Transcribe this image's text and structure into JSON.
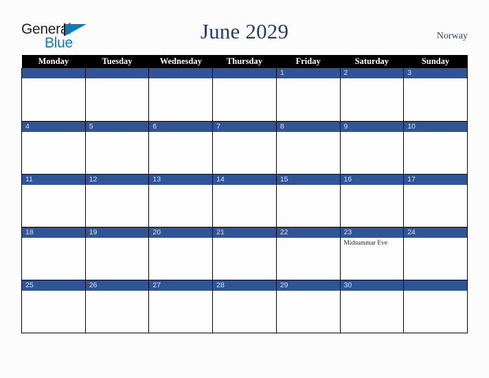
{
  "brand": {
    "line1": "General",
    "line2": "Blue",
    "triangle_color": "#0b7bc1",
    "text_color": "#231f20"
  },
  "header": {
    "title": "June 2029",
    "country": "Norway",
    "title_color": "#243c66"
  },
  "theme": {
    "header_bg": "#000000",
    "header_text": "#ffffff",
    "daybar_bg": "#2f5597",
    "daybar_text": "#dfe3ea",
    "cell_bg": "#fdfdfd",
    "page_bg": "#fcfcfd",
    "grid_line": "#000000"
  },
  "weekdays": [
    "Monday",
    "Tuesday",
    "Wednesday",
    "Thursday",
    "Friday",
    "Saturday",
    "Sunday"
  ],
  "weeks": [
    [
      {
        "day": "",
        "events": []
      },
      {
        "day": "",
        "events": []
      },
      {
        "day": "",
        "events": []
      },
      {
        "day": "",
        "events": []
      },
      {
        "day": "1",
        "events": []
      },
      {
        "day": "2",
        "events": []
      },
      {
        "day": "3",
        "events": []
      }
    ],
    [
      {
        "day": "4",
        "events": []
      },
      {
        "day": "5",
        "events": []
      },
      {
        "day": "6",
        "events": []
      },
      {
        "day": "7",
        "events": []
      },
      {
        "day": "8",
        "events": []
      },
      {
        "day": "9",
        "events": []
      },
      {
        "day": "10",
        "events": []
      }
    ],
    [
      {
        "day": "11",
        "events": []
      },
      {
        "day": "12",
        "events": []
      },
      {
        "day": "13",
        "events": []
      },
      {
        "day": "14",
        "events": []
      },
      {
        "day": "15",
        "events": []
      },
      {
        "day": "16",
        "events": []
      },
      {
        "day": "17",
        "events": []
      }
    ],
    [
      {
        "day": "18",
        "events": []
      },
      {
        "day": "19",
        "events": []
      },
      {
        "day": "20",
        "events": []
      },
      {
        "day": "21",
        "events": []
      },
      {
        "day": "22",
        "events": []
      },
      {
        "day": "23",
        "events": [
          "Midsummar Eve"
        ]
      },
      {
        "day": "24",
        "events": []
      }
    ],
    [
      {
        "day": "25",
        "events": []
      },
      {
        "day": "26",
        "events": []
      },
      {
        "day": "27",
        "events": []
      },
      {
        "day": "28",
        "events": []
      },
      {
        "day": "29",
        "events": []
      },
      {
        "day": "30",
        "events": []
      },
      {
        "day": "",
        "events": []
      }
    ]
  ]
}
